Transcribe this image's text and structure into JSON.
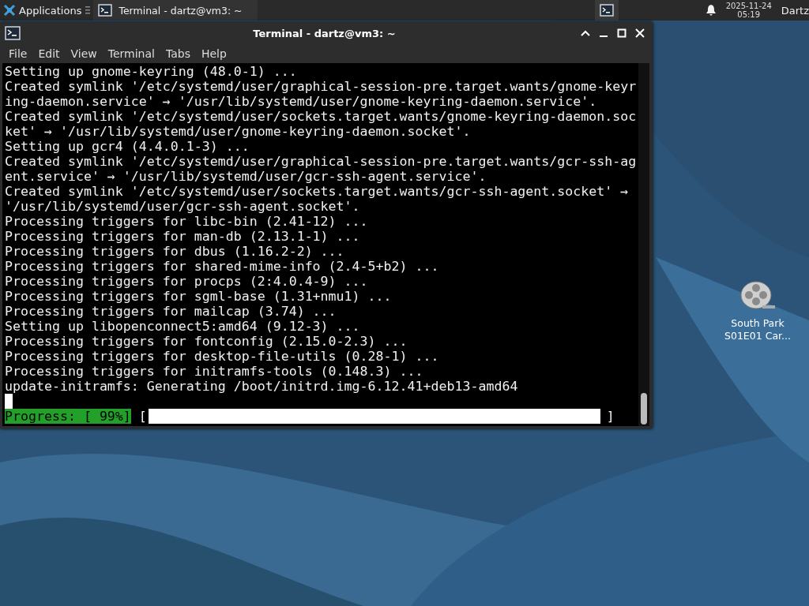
{
  "panel": {
    "apps_label": "Applications",
    "tasks": [
      {
        "label": "Terminal - dartz@vm3: ~",
        "selected": true
      }
    ],
    "date": "2025-11-24",
    "time": "05:19",
    "user": "Dartz"
  },
  "window": {
    "title": "Terminal - dartz@vm3: ~",
    "menu": [
      "File",
      "Edit",
      "View",
      "Terminal",
      "Tabs",
      "Help"
    ],
    "lines": [
      "Setting up gnome-keyring (48.0-1) ...",
      "Created symlink '/etc/systemd/user/graphical-session-pre.target.wants/gnome-keyr",
      "ing-daemon.service' → '/usr/lib/systemd/user/gnome-keyring-daemon.service'.",
      "Created symlink '/etc/systemd/user/sockets.target.wants/gnome-keyring-daemon.soc",
      "ket' → '/usr/lib/systemd/user/gnome-keyring-daemon.socket'.",
      "Setting up gcr4 (4.4.0.1-3) ...",
      "Created symlink '/etc/systemd/user/graphical-session-pre.target.wants/gcr-ssh-ag",
      "ent.service' → '/usr/lib/systemd/user/gcr-ssh-agent.service'.",
      "Created symlink '/etc/systemd/user/sockets.target.wants/gcr-ssh-agent.socket' →",
      "'/usr/lib/systemd/user/gcr-ssh-agent.socket'.",
      "Processing triggers for libc-bin (2.41-12) ...",
      "Processing triggers for man-db (2.13.1-1) ...",
      "Processing triggers for dbus (1.16.2-2) ...",
      "Processing triggers for shared-mime-info (2.4-5+b2) ...",
      "Processing triggers for procps (2:4.0.4-9) ...",
      "Processing triggers for sgml-base (1.31+nmu1) ...",
      "Processing triggers for mailcap (3.74) ...",
      "Setting up libopenconnect5:amd64 (9.12-3) ...",
      "Processing triggers for fontconfig (2.15.0-2.3) ...",
      "Processing triggers for desktop-file-utils (0.28-1) ...",
      "Processing triggers for initramfs-tools (0.148.3) ...",
      "update-initramfs: Generating /boot/initrd.img-6.12.41+deb13-amd64"
    ],
    "cursor_visible": true,
    "progress": {
      "label": "Progress: [ 99%]",
      "open": "[",
      "close": "]",
      "level": 0.99
    }
  },
  "desktop_icons": [
    {
      "label": "South Park S01E01 Car..."
    }
  ]
}
